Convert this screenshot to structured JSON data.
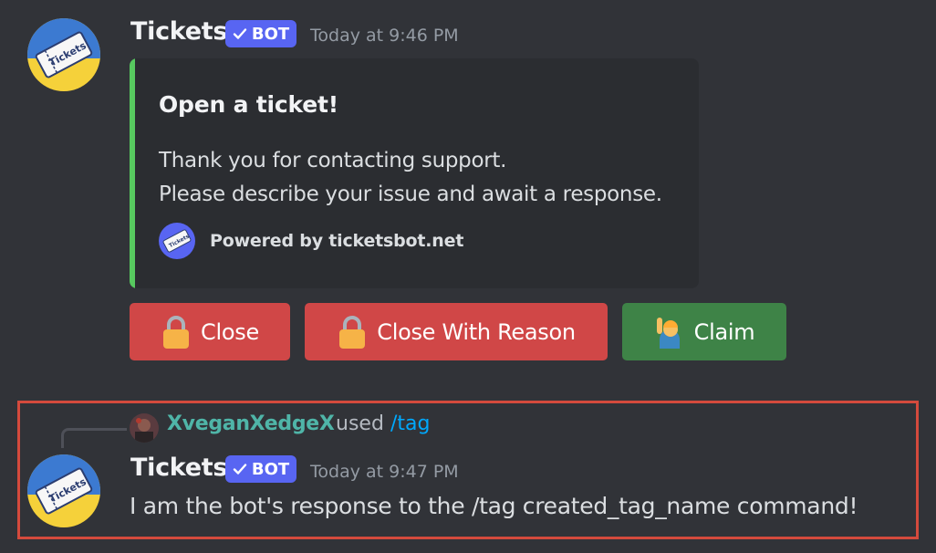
{
  "messages": [
    {
      "author": "Tickets",
      "badge": "BOT",
      "timestamp": "Today at 9:46 PM",
      "embed": {
        "title": "Open a ticket!",
        "description_line1": "Thank you for contacting support.",
        "description_line2": "Please describe your issue and await a response.",
        "footer": "Powered by ticketsbot.net",
        "accent_color": "#57c95f"
      },
      "buttons": [
        {
          "label": "Close",
          "style": "danger",
          "icon": "lock-icon"
        },
        {
          "label": "Close With Reason",
          "style": "danger",
          "icon": "lock-icon"
        },
        {
          "label": "Claim",
          "style": "success",
          "icon": "raising-hand-icon"
        }
      ]
    },
    {
      "reply": {
        "user": "XveganXedgeX",
        "used_text": "used",
        "command": "/tag"
      },
      "author": "Tickets",
      "badge": "BOT",
      "timestamp": "Today at 9:47 PM",
      "content": "I am the bot's response to the /tag created_tag_name command!"
    }
  ],
  "colors": {
    "background": "#313338",
    "badge": "#5865f2",
    "danger": "#d04747",
    "success": "#3e8347",
    "highlight_border": "#d44a3d",
    "reply_user": "#4fb5a8",
    "command_link": "#00a8fc"
  }
}
